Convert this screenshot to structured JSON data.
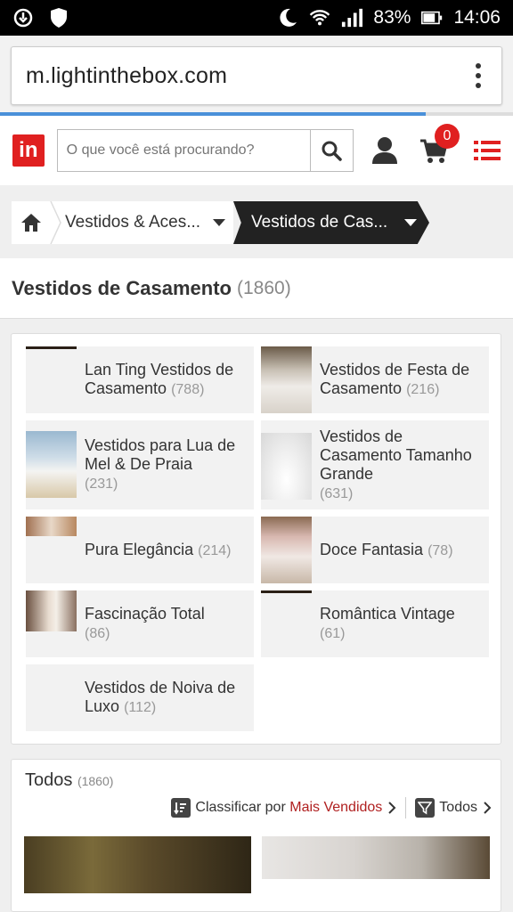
{
  "status_bar": {
    "battery": "83%",
    "time": "14:06"
  },
  "browser": {
    "url": "m.lightinthebox.com",
    "progress": 0.83
  },
  "header": {
    "logo": "in",
    "search_placeholder": "O que você está procurando?",
    "cart_count": "0"
  },
  "breadcrumb": {
    "item1": "Vestidos & Aces...",
    "item2": "Vestidos de Cas..."
  },
  "page": {
    "title": "Vestidos de Casamento",
    "count": "(1860)"
  },
  "categories": [
    {
      "name": "Lan Ting Vestidos de Casamento",
      "count": "(788)"
    },
    {
      "name": "Vestidos de Festa de Casamento",
      "count": "(216)"
    },
    {
      "name": "Vestidos para Lua de Mel & De Praia",
      "count": "(231)"
    },
    {
      "name": "Vestidos de Casamento Tamanho Grande",
      "count": "(631)"
    },
    {
      "name": "Pura Elegância",
      "count": "(214)"
    },
    {
      "name": "Doce Fantasia",
      "count": "(78)"
    },
    {
      "name": "Fascinação Total",
      "count": "(86)"
    },
    {
      "name": "Romântica Vintage",
      "count": "(61)"
    },
    {
      "name": "Vestidos de Noiva de Luxo",
      "count": "(112)"
    }
  ],
  "listing": {
    "title": "Todos",
    "count": "(1860)",
    "sort_label": "Classificar por",
    "sort_value": "Mais Vendidos",
    "filter_label": "Todos"
  },
  "colors": {
    "brand_red": "#e02020",
    "sort_red": "#b02020",
    "progress_blue": "#4a90d9"
  }
}
